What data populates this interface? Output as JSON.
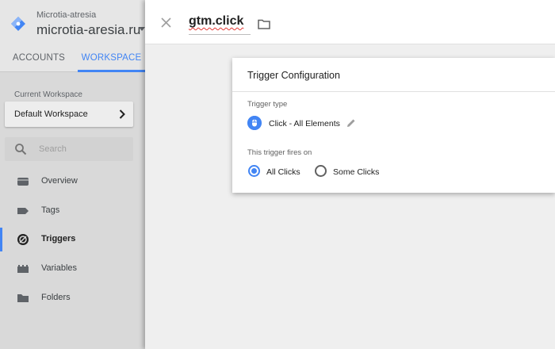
{
  "header": {
    "account_name": "Microtia-atresia",
    "container_name": "microtia-aresia.ru"
  },
  "tabs": [
    {
      "label": "ACCOUNTS",
      "active": false
    },
    {
      "label": "WORKSPACE",
      "active": true
    }
  ],
  "workspace": {
    "section_label": "Current Workspace",
    "name": "Default Workspace"
  },
  "search": {
    "placeholder": "Search"
  },
  "nav": [
    {
      "label": "Overview",
      "icon": "overview-icon",
      "active": false
    },
    {
      "label": "Tags",
      "icon": "tag-icon",
      "active": false
    },
    {
      "label": "Triggers",
      "icon": "trigger-icon",
      "active": true
    },
    {
      "label": "Variables",
      "icon": "variables-icon",
      "active": false
    },
    {
      "label": "Folders",
      "icon": "folder-icon",
      "active": false
    }
  ],
  "editor": {
    "title": "gtm.click"
  },
  "trigger_config": {
    "heading": "Trigger Configuration",
    "type_label": "Trigger type",
    "type_name": "Click - All Elements",
    "fires_label": "This trigger fires on",
    "options": [
      {
        "label": "All Clicks",
        "selected": true
      },
      {
        "label": "Some Clicks",
        "selected": false
      }
    ]
  },
  "colors": {
    "accent": "#4285f4",
    "sidebar_bg": "#d9d9d9",
    "main_bg": "#efefef"
  }
}
